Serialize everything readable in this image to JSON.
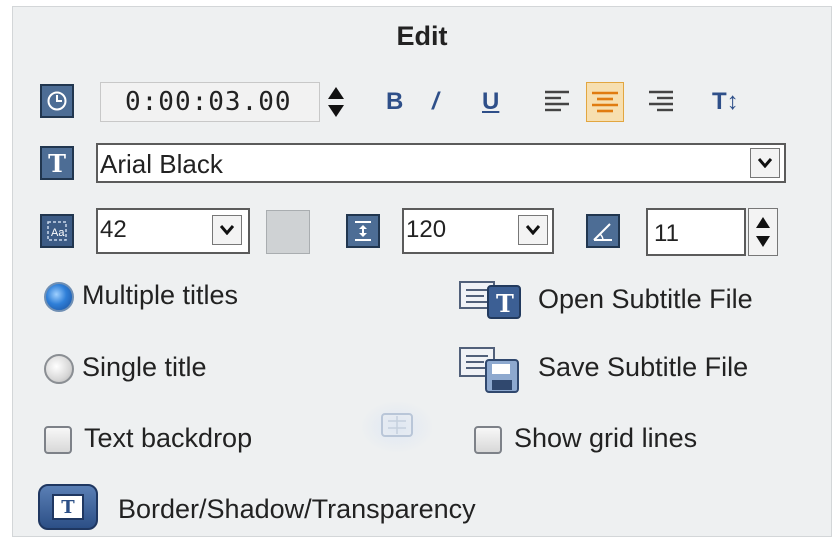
{
  "header": {
    "title": "Edit"
  },
  "toolbar": {
    "duration": "0:00:03.00",
    "bold_label": "B",
    "italic_label": "/",
    "underline_label": "U",
    "vertical_label": "T↕"
  },
  "font": {
    "family": "Arial Black"
  },
  "size": {
    "value": "42"
  },
  "line_spacing": {
    "value": "120"
  },
  "angle": {
    "value": "11"
  },
  "options": {
    "multiple_titles": "Multiple titles",
    "single_title": "Single title",
    "text_backdrop": "Text backdrop",
    "show_grid_lines": "Show grid lines",
    "open_subtitle": "Open Subtitle File",
    "save_subtitle": "Save Subtitle File",
    "border_shadow": "Border/Shadow/Transparency",
    "multiple_titles_selected": true
  },
  "icons": {
    "clock": "clock-icon",
    "text": "text-T-icon",
    "font_size": "font-size-icon",
    "line_spacing": "line-spacing-icon",
    "angle": "angle-icon",
    "open": "open-subtitle-icon",
    "save": "save-subtitle-icon",
    "border": "border-shadow-icon"
  },
  "colors": {
    "accent": "#2e4f89",
    "panel": "#eef0f1",
    "icon_bg": "#4d6d95"
  }
}
